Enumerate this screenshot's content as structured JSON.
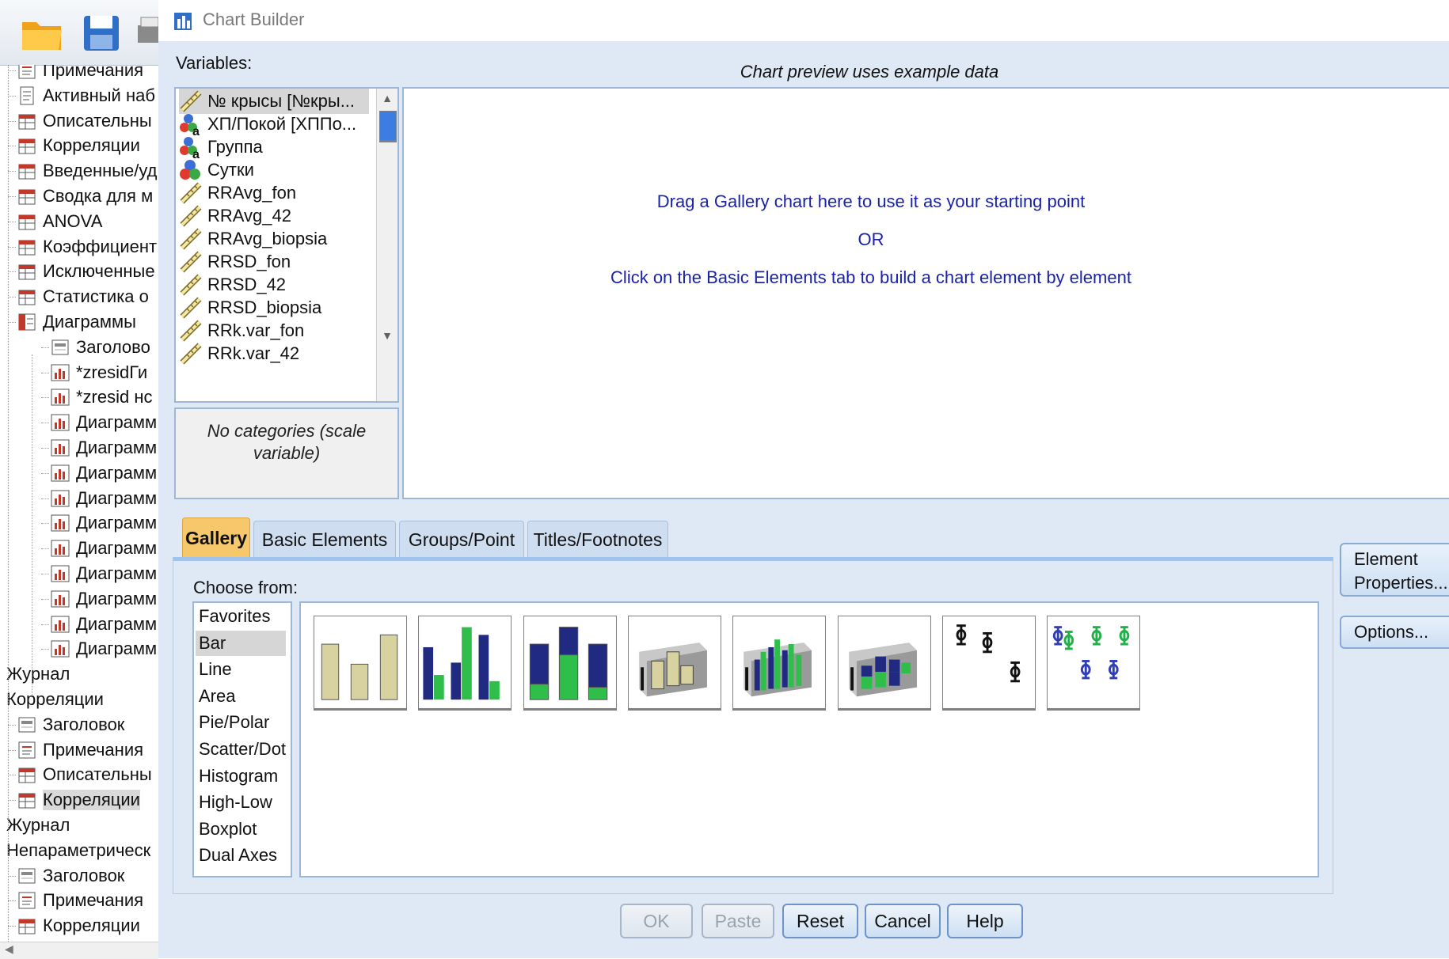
{
  "viewer": {
    "tree": [
      {
        "label": "Примечания",
        "icon": "notes-icon",
        "indent": 0
      },
      {
        "label": "Активный наб",
        "icon": "dataset-icon",
        "indent": 0
      },
      {
        "label": "Описательны",
        "icon": "table-icon",
        "indent": 0
      },
      {
        "label": "Корреляции",
        "icon": "table-icon",
        "indent": 0
      },
      {
        "label": "Введенные/уд",
        "icon": "table-icon",
        "indent": 0
      },
      {
        "label": "Сводка для м",
        "icon": "table-icon",
        "indent": 0
      },
      {
        "label": "ANOVA",
        "icon": "table-icon",
        "indent": 0
      },
      {
        "label": "Коэффициент",
        "icon": "table-icon",
        "indent": 0
      },
      {
        "label": "Исключенные",
        "icon": "table-icon",
        "indent": 0
      },
      {
        "label": "Статистика о",
        "icon": "table-icon",
        "indent": 0
      },
      {
        "label": "Диаграммы",
        "icon": "folder-icon",
        "indent": 0
      },
      {
        "label": "Заголово",
        "icon": "title-icon",
        "indent": 1
      },
      {
        "label": "*zresidГи",
        "icon": "chart-icon",
        "indent": 1
      },
      {
        "label": "*zresid нс",
        "icon": "chart-icon",
        "indent": 1
      },
      {
        "label": "Диаграмм",
        "icon": "chart-icon",
        "indent": 1
      },
      {
        "label": "Диаграмм",
        "icon": "chart-icon",
        "indent": 1
      },
      {
        "label": "Диаграмм",
        "icon": "chart-icon",
        "indent": 1
      },
      {
        "label": "Диаграмм",
        "icon": "chart-icon",
        "indent": 1
      },
      {
        "label": "Диаграмм",
        "icon": "chart-icon",
        "indent": 1
      },
      {
        "label": "Диаграмм",
        "icon": "chart-icon",
        "indent": 1
      },
      {
        "label": "Диаграмм",
        "icon": "chart-icon",
        "indent": 1
      },
      {
        "label": "Диаграмм",
        "icon": "chart-icon",
        "indent": 1
      },
      {
        "label": "Диаграмм",
        "icon": "chart-icon",
        "indent": 1
      },
      {
        "label": "Диаграмм",
        "icon": "chart-icon",
        "indent": 1
      },
      {
        "label": "Журнал",
        "icon": "",
        "indent": -1
      },
      {
        "label": "Корреляции",
        "icon": "",
        "indent": -1
      },
      {
        "label": "Заголовок",
        "icon": "title-icon",
        "indent": 0
      },
      {
        "label": "Примечания",
        "icon": "notes-icon",
        "indent": 0
      },
      {
        "label": "Описательны",
        "icon": "table-icon",
        "indent": 0
      },
      {
        "label": "Корреляции",
        "icon": "table-icon",
        "indent": 0,
        "selected": true
      },
      {
        "label": "Журнал",
        "icon": "",
        "indent": -1
      },
      {
        "label": "Непараметрическ",
        "icon": "",
        "indent": -1
      },
      {
        "label": "Заголовок",
        "icon": "title-icon",
        "indent": 0
      },
      {
        "label": "Примечания",
        "icon": "notes-icon",
        "indent": 0
      },
      {
        "label": "Корреляции",
        "icon": "table-icon",
        "indent": 0
      }
    ]
  },
  "dialog": {
    "title": "Chart Builder",
    "variables_label": "Variables:",
    "preview_caption": "Chart preview uses example data",
    "variables": [
      {
        "name": "№ крысы [№кры...",
        "type": "scale-icon",
        "selected": true
      },
      {
        "name": "ХП/Покой [ХППо...",
        "type": "nominal-string-icon"
      },
      {
        "name": "Группа",
        "type": "nominal-string-icon"
      },
      {
        "name": "Сутки",
        "type": "nominal-icon"
      },
      {
        "name": "RRAvg_fon",
        "type": "scale-icon"
      },
      {
        "name": "RRAvg_42",
        "type": "scale-icon"
      },
      {
        "name": "RRAvg_biopsia",
        "type": "scale-icon"
      },
      {
        "name": "RRSD_fon",
        "type": "scale-icon"
      },
      {
        "name": "RRSD_42",
        "type": "scale-icon"
      },
      {
        "name": "RRSD_biopsia",
        "type": "scale-icon"
      },
      {
        "name": "RRk.var_fon",
        "type": "scale-icon"
      },
      {
        "name": "RRk.var_42",
        "type": "scale-icon"
      }
    ],
    "no_categories": [
      "No categories (scale",
      "variable)"
    ],
    "preview_text": {
      "line1": "Drag a Gallery chart here to use it as your starting point",
      "line2": "OR",
      "line3": "Click on the Basic Elements tab to build a chart element by element"
    },
    "tabs": [
      {
        "label": "Gallery",
        "active": true
      },
      {
        "label": "Basic Elements"
      },
      {
        "label": "Groups/Point ID"
      },
      {
        "label": "Titles/Footnotes"
      }
    ],
    "choose_from_label": "Choose from:",
    "chart_types": [
      "Favorites",
      "Bar",
      "Line",
      "Area",
      "Pie/Polar",
      "Scatter/Dot",
      "Histogram",
      "High-Low",
      "Boxplot",
      "Dual Axes"
    ],
    "selected_chart_type": "Bar",
    "gallery_thumbnails": [
      "simple-bar-icon",
      "clustered-bar-icon",
      "stacked-bar-icon",
      "simple-3d-bar-icon",
      "clustered-3d-bar-icon",
      "stacked-3d-bar-icon",
      "simple-error-bar-icon",
      "clustered-error-bar-icon"
    ],
    "side_buttons": {
      "element_properties": [
        "Element",
        "Properties..."
      ],
      "options": "Options..."
    },
    "buttons": {
      "ok": "OK",
      "paste": "Paste",
      "reset": "Reset",
      "cancel": "Cancel",
      "help": "Help"
    },
    "colors": {
      "accent_tab": "#f6c86b",
      "preview_text": "#1a23a8",
      "bar_tan": "#d8d1a0",
      "bar_navy": "#1f2a80",
      "bar_green": "#2fbe4a",
      "errorbar_blue": "#2e3fb8",
      "errorbar_green": "#22b04a"
    }
  }
}
